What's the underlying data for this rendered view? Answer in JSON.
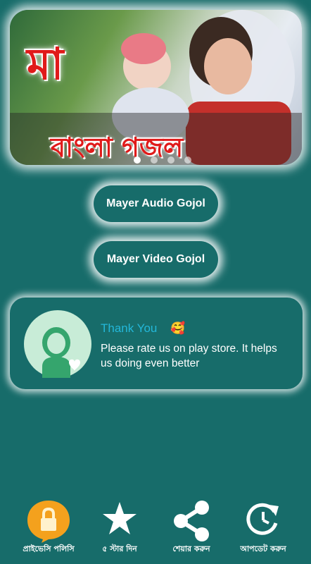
{
  "banner": {
    "word_top": "মা",
    "word_bottom": "বাংলা গজল",
    "slides": 4,
    "active_slide": 0
  },
  "buttons": {
    "audio_label": "Mayer Audio Gojol",
    "video_label": "Mayer Video Gojol"
  },
  "card": {
    "title": "Thank You",
    "emoji": "🥰",
    "message": "Please rate us on play store. It helps us doing even better"
  },
  "bottom_nav": {
    "items": [
      {
        "label": "প্রাইভেসি পলিসি",
        "icon": "lock-icon"
      },
      {
        "label": "৫ স্টার দিন",
        "icon": "star-icon"
      },
      {
        "label": "শেয়ার করুন",
        "icon": "share-icon"
      },
      {
        "label": "আপডেট করুন",
        "icon": "update-icon"
      }
    ]
  },
  "colors": {
    "background": "#176c6a",
    "accent_title": "#23b7d9",
    "banner_text": "#e01a1a"
  }
}
